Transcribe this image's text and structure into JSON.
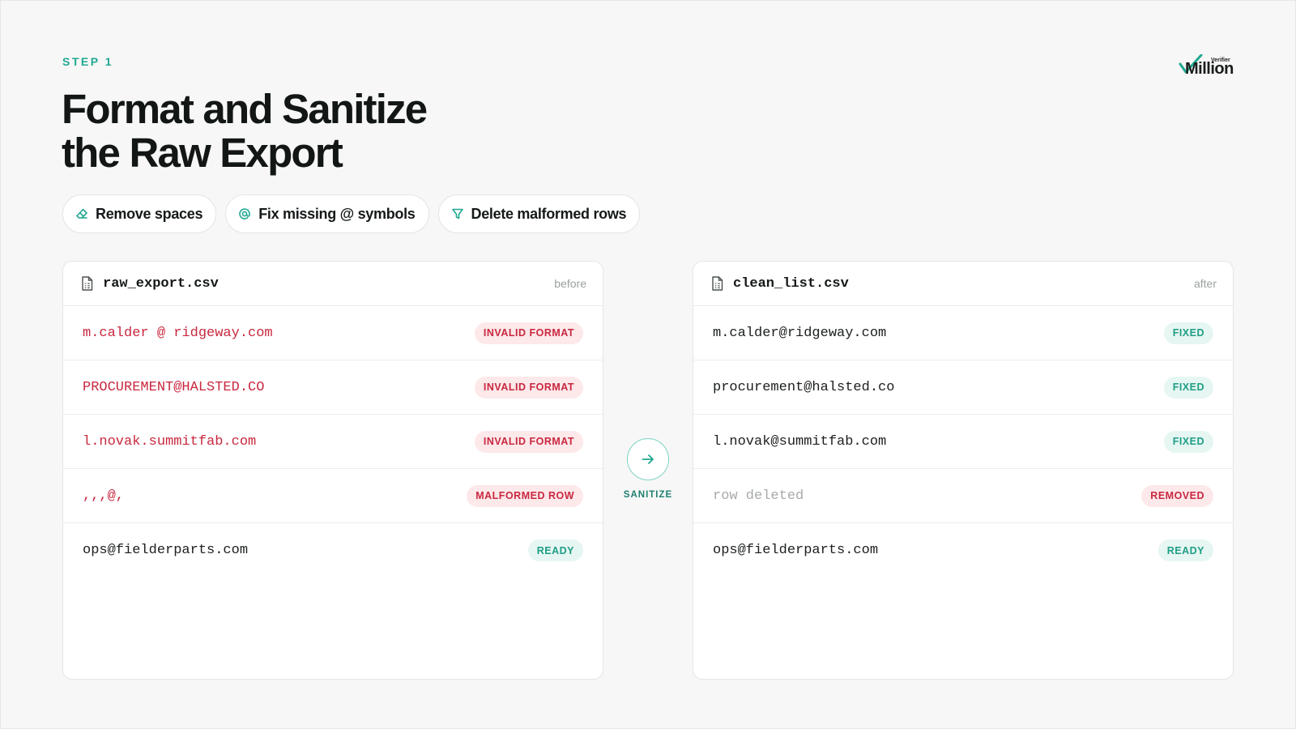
{
  "step_label": "STEP 1",
  "title_line1": "Format and Sanitize",
  "title_line2": "the Raw Export",
  "logo": {
    "small": "Verifier",
    "main": "Million"
  },
  "chips": [
    {
      "label": "Remove spaces",
      "icon": "eraser-icon"
    },
    {
      "label": "Fix missing @ symbols",
      "icon": "at-icon"
    },
    {
      "label": "Delete malformed rows",
      "icon": "filter-icon"
    }
  ],
  "before": {
    "filename": "raw_export.csv",
    "tag": "before",
    "rows": [
      {
        "email": "m.calder @ ridgeway.com",
        "status": "INVALID FORMAT"
      },
      {
        "email": "PROCUREMENT@HALSTED.CO",
        "status": "INVALID FORMAT"
      },
      {
        "email": "l.novak.summitfab.com",
        "status": "INVALID FORMAT"
      },
      {
        "email": ",,,@,",
        "status": "MALFORMED ROW"
      },
      {
        "email": "ops@fielderparts.com",
        "status": "READY"
      }
    ]
  },
  "action_label": "SANITIZE",
  "after": {
    "filename": "clean_list.csv",
    "tag": "after",
    "rows": [
      {
        "email": "m.calder@ridgeway.com",
        "status": "FIXED"
      },
      {
        "email": "procurement@halsted.co",
        "status": "FIXED"
      },
      {
        "email": "l.novak@summitfab.com",
        "status": "FIXED"
      },
      {
        "email": "row deleted",
        "status": "REMOVED"
      },
      {
        "email": "ops@fielderparts.com",
        "status": "READY"
      }
    ]
  },
  "colors": {
    "accent": "#22a892",
    "error": "#c8283f",
    "success": "#1f9e86",
    "background": "#f6f7f6"
  }
}
